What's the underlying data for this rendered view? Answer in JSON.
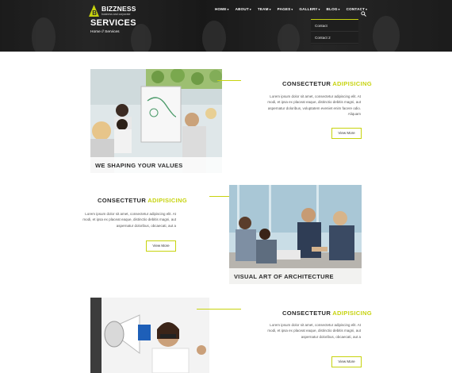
{
  "brand": {
    "name": "BIZZNESS",
    "tagline": "business and corporate"
  },
  "nav": {
    "items": [
      {
        "label": "HOME"
      },
      {
        "label": "ABOUT"
      },
      {
        "label": "TEAM"
      },
      {
        "label": "PAGES"
      },
      {
        "label": "GALLERY"
      },
      {
        "label": "BLOG"
      },
      {
        "label": "CONTACT"
      }
    ],
    "caret": "▾",
    "dropdown": [
      "Contact",
      "Contact 2"
    ]
  },
  "header": {
    "title": "SERVICES",
    "breadcrumb_home": "Home",
    "breadcrumb_sep": " // ",
    "breadcrumb_current": "Services"
  },
  "sections": [
    {
      "title_main": "CONSECTETUR ",
      "title_accent": "ADIPISICING",
      "text": "Lorem ipsum dolor sit amet, consectetur adipiscing elit. At modi, et ipsa ex placeat eaque, distinctio debitis magni, aut aspernatur doloribus, voluptatem eveniet enim facere odio. Aliquam",
      "button": "View More",
      "caption": "WE SHAPING YOUR VALUES"
    },
    {
      "title_main": "CONSECTETUR ",
      "title_accent": "ADIPISICING",
      "text": "Lorem ipsum dolor sit amet, consectetur adipiscing elit. At modi, et ipsa ex placeat eaque, distinctio debitis magni, aut aspernatur doloribus, obcaecati, aut a",
      "button": "View More",
      "caption": "VISUAL ART OF ARCHITECTURE"
    },
    {
      "title_main": "CONSECTETUR ",
      "title_accent": "ADIPISICING",
      "text": "Lorem ipsum dolor sit amet, consectetur adipiscing elit. At modi, et ipsa ex placeat eaque, distinctio debitis magni, aut aspernatur doloribus, obcaecati, aut a",
      "button": "View More"
    }
  ],
  "colors": {
    "accent": "#c7d30e",
    "dark": "#2a2a2a"
  },
  "icons": {
    "search": "search-icon",
    "logo": "logo-mark-icon"
  }
}
